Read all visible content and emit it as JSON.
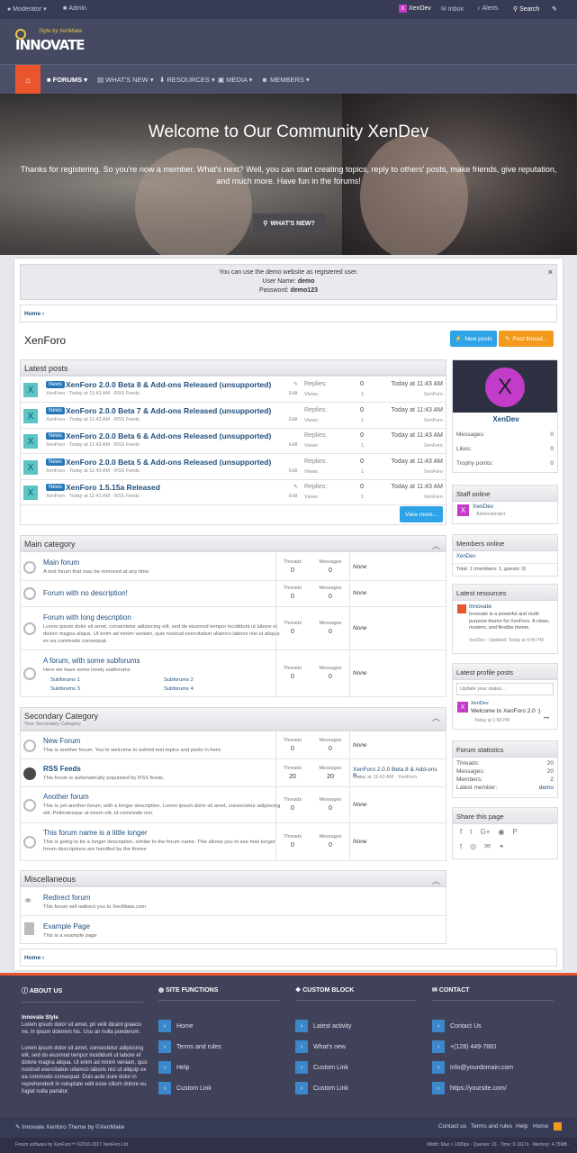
{
  "topbar": {
    "moderator": "Moderator",
    "admin": "Admin",
    "user": "XenDev",
    "inbox": "Inbox",
    "alerts": "Alerts",
    "search": "Search"
  },
  "logo": {
    "small": "Style by XenMake",
    "big": "INNOVATE"
  },
  "nav": {
    "forums": "FORUMS",
    "whats_new": "WHAT'S NEW",
    "resources": "RESOURCES",
    "media": "MEDIA",
    "members": "MEMBERS"
  },
  "hero": {
    "title": "Welcome to Our Community XenDev",
    "subtitle": "Thanks for registering. So you're now a member. What's next? Well, you can start creating topics, reply to others' posts, make friends, give reputation, and much more. Have fun in the forums!",
    "button": "WHAT'S NEW?"
  },
  "notice": {
    "line1": "You can use the demo website as registered user.",
    "user_label": "User Name:",
    "user_value": "demo",
    "pass_label": "Password:",
    "pass_value": "demo123",
    "close": "×"
  },
  "breadcrumb": {
    "home": "Home"
  },
  "page": {
    "title": "XenForo",
    "new_posts": "New posts",
    "post_thread": "Post thread..."
  },
  "latest_posts": {
    "heading": "Latest posts",
    "replies_label": "Replies:",
    "views_label": "Views:",
    "edit": "Edit",
    "view_more": "View more...",
    "items": [
      {
        "tag": "News",
        "title": "XenForo 2.0.0 Beta 8 & Add-ons Released (unsupported)",
        "meta": "XenForo · Today at 11:43 AM · RSS Feeds",
        "replies": "0",
        "views": "2",
        "date": "Today at 11:43 AM",
        "author": "XenForo",
        "avatar": "X"
      },
      {
        "tag": "News",
        "title": "XenForo 2.0.0 Beta 7 & Add-ons Released (unsupported)",
        "meta": "XenForo · Today at 11:43 AM · RSS Feeds",
        "replies": "0",
        "views": "1",
        "date": "Today at 11:43 AM",
        "author": "XenForo",
        "avatar": "X"
      },
      {
        "tag": "News",
        "title": "XenForo 2.0.0 Beta 6 & Add-ons Released (unsupported)",
        "meta": "XenForo · Today at 11:43 AM · RSS Feeds",
        "replies": "0",
        "views": "1",
        "date": "Today at 11:43 AM",
        "author": "XenForo",
        "avatar": "X"
      },
      {
        "tag": "News",
        "title": "XenForo 2.0.0 Beta 5 & Add-ons Released (unsupported)",
        "meta": "XenForo · Today at 11:43 AM · RSS Feeds",
        "replies": "0",
        "views": "1",
        "date": "Today at 11:43 AM",
        "author": "XenForo",
        "avatar": "X"
      },
      {
        "tag": "News",
        "title": "XenForo 1.5.15a Released",
        "meta": "XenForo · Today at 11:43 AM · RSS Feeds",
        "replies": "0",
        "views": "1",
        "date": "Today at 11:43 AM",
        "author": "XenForo",
        "avatar": "X"
      }
    ]
  },
  "forum_labels": {
    "threads": "Threads",
    "messages": "Messages",
    "none": "None"
  },
  "main_category": {
    "heading": "Main category",
    "forums": [
      {
        "name": "Main forum",
        "desc": "A test forum that may be removed at any time.",
        "threads": "0",
        "messages": "0",
        "latest": "None"
      },
      {
        "name": "Forum with no description!",
        "desc": "",
        "threads": "0",
        "messages": "0",
        "latest": "None"
      },
      {
        "name": "Forum with long description",
        "desc": "Lorem ipsum dolor sit amet, consectetur adipiscing elit, sed do eiusmod tempor incididunt ut labore et dolore magna aliqua. Ut enim ad minim veniam, quis nostrud exercitation ullamco laboris nisi ut aliquip ex ea commodo consequat.",
        "threads": "0",
        "messages": "0",
        "latest": "None"
      },
      {
        "name": "A forum, with some subforums",
        "desc": "Here we have some lovely subforums",
        "threads": "0",
        "messages": "0",
        "latest": "None",
        "subforums": [
          "Subforums 1",
          "Subforums 2",
          "Subforums 3",
          "Subforums 4"
        ]
      }
    ]
  },
  "secondary_category": {
    "heading": "Secondary Category",
    "subheading": "Your Secondary Category",
    "forums": [
      {
        "name": "New Forum",
        "desc": "This is another forum. You're welcome to submit test topics and posts in here.",
        "threads": "0",
        "messages": "0",
        "latest": "None"
      },
      {
        "name": "RSS Feeds",
        "desc": "This forum is automatically populated by RSS feeds.",
        "threads": "20",
        "messages": "20",
        "latest": "XenForo 2.0.0 Beta 8 & Add-ons R...",
        "latest_meta": "Today at 11:43 AM · XenForo"
      },
      {
        "name": "Another forum",
        "desc": "This is yet another forum, with a longer description. Lorem ipsum dolor sit amet, consectetur adipiscing elit. Pellentesque at lorem elit, id commodo nisi.",
        "threads": "0",
        "messages": "0",
        "latest": "None"
      },
      {
        "name": "This forum name is a little longer",
        "desc": "This is going to be a longer description, similar to the forum name. This allows you to see how longer forum descriptions are handled by the theme",
        "threads": "0",
        "messages": "0",
        "latest": "None"
      }
    ]
  },
  "misc_category": {
    "heading": "Miscellaneous",
    "items": [
      {
        "name": "Redirect forum",
        "desc": "This forum will redirect you to XenMake.com"
      },
      {
        "name": "Example Page",
        "desc": "This is a example page"
      }
    ]
  },
  "sidebar": {
    "profile": {
      "avatar": "X",
      "name": "XenDev",
      "messages_label": "Messages:",
      "messages": "0",
      "likes_label": "Likes:",
      "likes": "0",
      "trophy_label": "Trophy points:",
      "trophy": "0"
    },
    "staff_online": {
      "heading": "Staff online",
      "name": "XenDev",
      "role": "Administrator"
    },
    "members_online": {
      "heading": "Members online",
      "member": "XenDev",
      "total": "Total: 1 (members: 1, guests: 0)"
    },
    "latest_resources": {
      "heading": "Latest resources",
      "title": "Innovate",
      "desc": "Innovate is a powerful and multi-purpose theme for XenForo. A clean, modern, and flexible theme.",
      "meta": "XenDev · Updated: Today at 4:45 PM"
    },
    "latest_profile_posts": {
      "heading": "Latest profile posts",
      "placeholder": "Update your status...",
      "author": "XenDev",
      "text": "Welcome to XenForo 2.0 :)",
      "time": "Today at 1:58 PM",
      "more": "•••"
    },
    "forum_stats": {
      "heading": "Forum statistics",
      "threads_label": "Threads:",
      "threads": "20",
      "messages_label": "Messages:",
      "messages": "20",
      "members_label": "Members:",
      "members": "2",
      "latest_label": "Latest member:",
      "latest": "demo"
    },
    "share": {
      "heading": "Share this page"
    }
  },
  "footer": {
    "about_head": "ABOUT US",
    "about_title": "Innovate Style",
    "about_p1": "Lorem ipsum dolor sit amet, pri velit dicant graecis ne, in ipsum dolorem his. Usu an nulla ponderum.",
    "about_p2": "Lorem ipsum dolor sit amet, consectetur adipiscing elit, sed do eiusmod tempor incididunt ut labore et dolore magna aliqua. Ut enim ad minim veniam, quis nostrud exercitation ullamco laboris nisi ut aliquip ex ea commodo consequat. Duis aute irure dolor in reprehenderit in voluptate velit esse cillum dolore eu fugiat nulla pariatur.",
    "site_head": "SITE FUNCTIONS",
    "site_links": [
      "Home",
      "Terms and rules",
      "Help",
      "Custom Link"
    ],
    "custom_head": "CUSTOM BLOCK",
    "custom_links": [
      "Latest activity",
      "What's new",
      "Custom Link",
      "Custom Link"
    ],
    "contact_head": "CONTACT",
    "contact_links": [
      "Contact Us",
      "+(128) 449-7881",
      "info@yourdomain.com",
      "https://yoursite.com/"
    ],
    "theme_credit": "Innovate Xenforo Theme by ©XenMake",
    "bottom_links": [
      "Contact us",
      "Terms and rules",
      "Help",
      "Home"
    ],
    "software": "Forum software by XenForo™ ©2010-2017 XenForo Ltd.",
    "stats": "Width: Max > 1300px · Queries: 16 · Time: 0.1617s · Memory: 4.75MB ·"
  }
}
